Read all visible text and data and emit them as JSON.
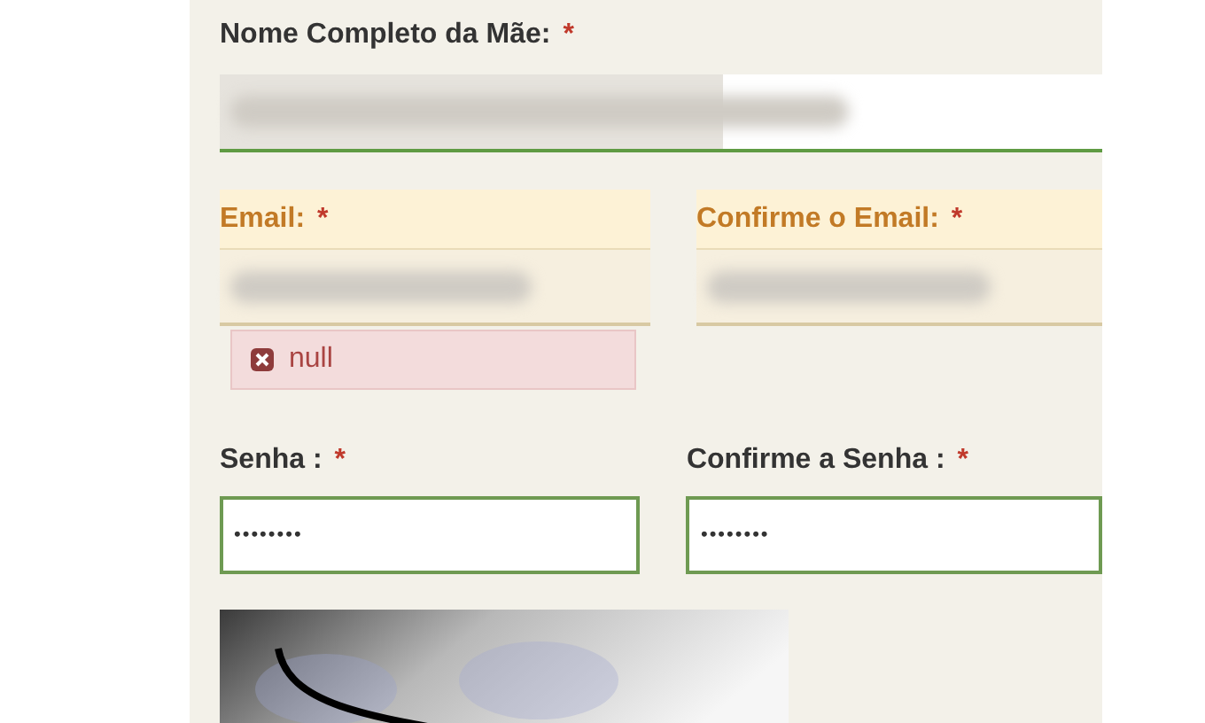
{
  "mother_name": {
    "label": "Nome Completo da Mãe:",
    "required_mark": "*",
    "redacted": true
  },
  "email_fields": [
    {
      "label": "Email:",
      "required_mark": "*",
      "redacted": true,
      "warning": true
    },
    {
      "label": "Confirme o Email:",
      "required_mark": "*",
      "redacted": true,
      "warning": true
    }
  ],
  "error": {
    "text": "null"
  },
  "password_fields": [
    {
      "label": "Senha :",
      "required_mark": "*",
      "value": "••••••••"
    },
    {
      "label": "Confirme a Senha :",
      "required_mark": "*",
      "value": "••••••••"
    }
  ]
}
